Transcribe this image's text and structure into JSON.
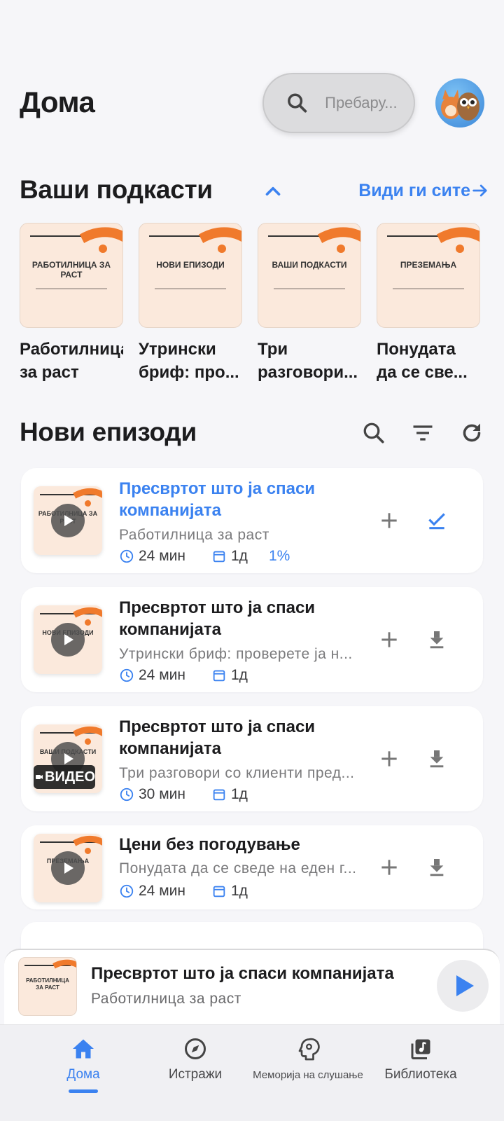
{
  "header": {
    "title": "Дома",
    "search_placeholder": "Пребару..."
  },
  "podcasts_section": {
    "title": "Ваши подкасти",
    "see_all": "Види ги сите",
    "items": [
      {
        "cover_title": "РАБОТИЛНИЦА ЗА РАСТ",
        "name": "Работилница за раст"
      },
      {
        "cover_title": "НОВИ ЕПИЗОДИ",
        "name": "Утрински бриф: про..."
      },
      {
        "cover_title": "ВАШИ ПОДКАСТИ",
        "name": "Три разговори..."
      },
      {
        "cover_title": "ПРЕЗЕМАЊА",
        "name": "Понудата да се све..."
      }
    ]
  },
  "episodes_section": {
    "title": "Нови епизоди",
    "items": [
      {
        "thumb_title": "РАБОТИЛНИЦА ЗА РАСТ",
        "title": "Пресвртот што ја спаси компанијата",
        "podcast": "Работилница за раст",
        "duration": "24 мин",
        "date": "1д",
        "progress": "1%",
        "action_icon": "check-icon"
      },
      {
        "thumb_title": "НОВИ ЕПИЗОДИ",
        "title": "Пресвртот што ја спаси компанијата",
        "podcast": "Утрински бриф: проверете ја н...",
        "duration": "24 мин",
        "date": "1д",
        "action_icon": "download-icon"
      },
      {
        "thumb_title": "ВАШИ ПОДКАСТИ",
        "title": "Пресвртот што ја спаси компанијата",
        "podcast": "Три разговори со клиенти пред...",
        "duration": "30 мин",
        "date": "1д",
        "badge": "ВИДЕО",
        "action_icon": "download-icon"
      },
      {
        "thumb_title": "ПРЕЗЕМАЊА",
        "title": "Цени без погодување",
        "podcast": "Понудата да се сведе на еден г...",
        "duration": "24 мин",
        "date": "1д",
        "action_icon": "download-icon"
      }
    ]
  },
  "mini_player": {
    "cover_title": "РАБОТИЛНИЦА ЗА РАСТ",
    "title": "Пресвртот што ја спаси компанијата",
    "podcast": "Работилница за раст"
  },
  "nav": {
    "items": [
      {
        "label": "Дома",
        "icon": "home-icon",
        "active": true
      },
      {
        "label": "Истражи",
        "icon": "compass-icon"
      },
      {
        "label": "Меморија на слушање",
        "icon": "brain-icon"
      },
      {
        "label": "Библиотека",
        "icon": "library-icon"
      }
    ]
  },
  "colors": {
    "accent": "#3b82f0",
    "cover_bg": "#fbe9dc",
    "cover_arc": "#f07a2c"
  }
}
